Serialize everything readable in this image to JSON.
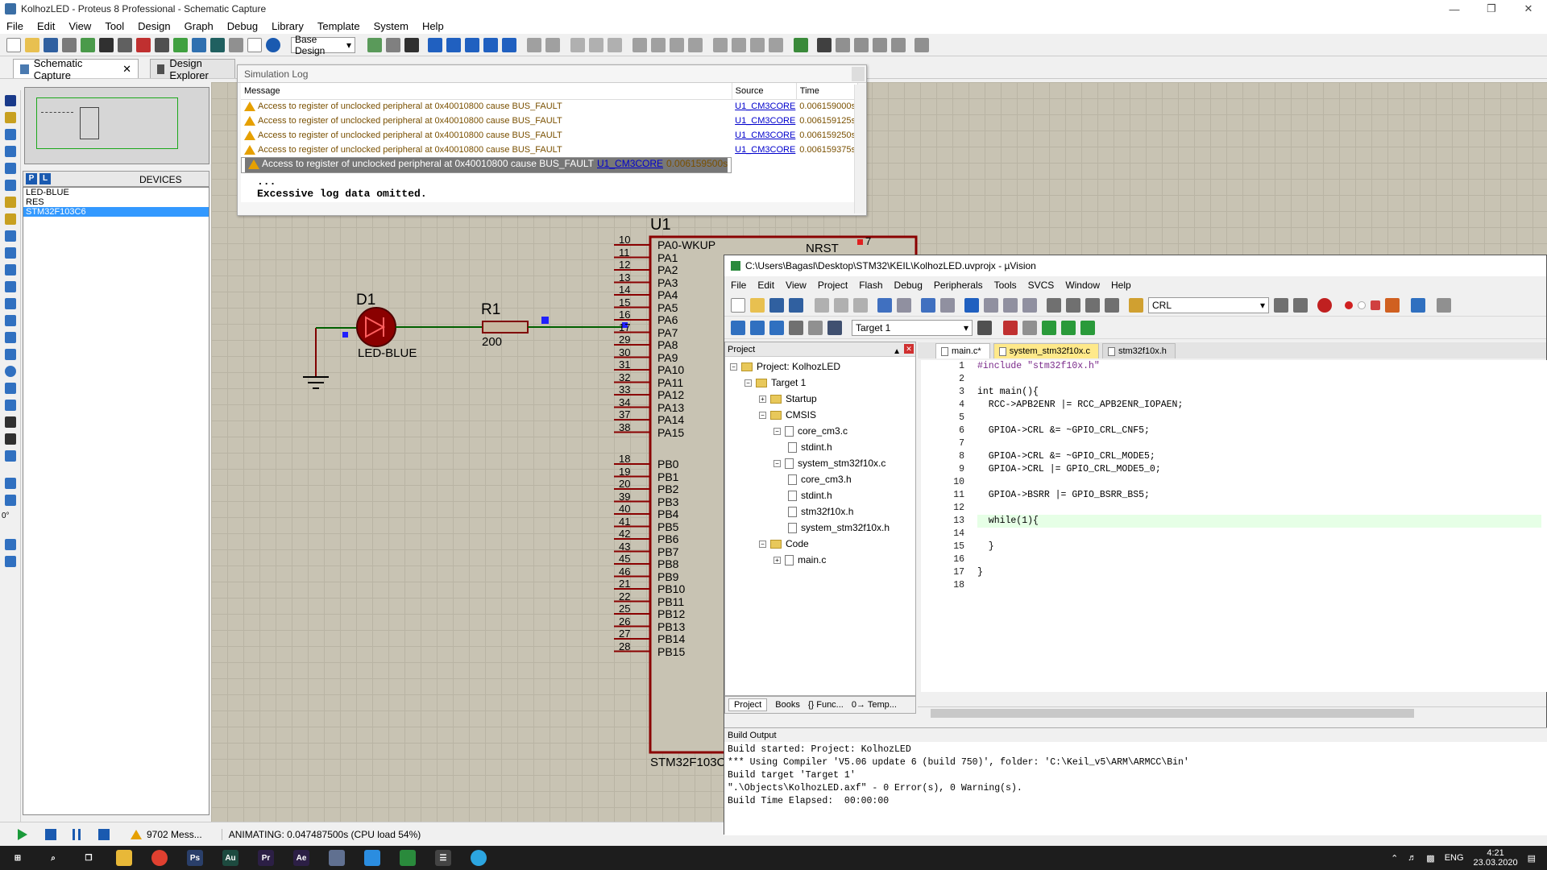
{
  "proteus": {
    "title": "KolhozLED - Proteus 8 Professional - Schematic Capture",
    "menu": [
      "File",
      "Edit",
      "View",
      "Tool",
      "Design",
      "Graph",
      "Debug",
      "Library",
      "Template",
      "System",
      "Help"
    ],
    "design_select": "Base Design",
    "tabs": {
      "schematic": "Schematic Capture",
      "explorer": "Design Explorer"
    },
    "devices_label": "DEVICES",
    "devices_p": "P",
    "devices_l": "L",
    "devices": [
      "LED-BLUE",
      "RES",
      "STM32F103C6"
    ],
    "rotation": "0°",
    "status_messages": "9702 Mess...",
    "status_animating": "ANIMATING: 0.047487500s (CPU load 54%)"
  },
  "simlog": {
    "title": "Simulation Log",
    "columns": [
      "Message",
      "Source",
      "Time"
    ],
    "rows": [
      {
        "message": "Access to register of unclocked peripheral at 0x40010800 cause BUS_FAULT",
        "source": "U1_CM3CORE",
        "time": "0.006159000s"
      },
      {
        "message": "Access to register of unclocked peripheral at 0x40010800 cause BUS_FAULT",
        "source": "U1_CM3CORE",
        "time": "0.006159125s"
      },
      {
        "message": "Access to register of unclocked peripheral at 0x40010800 cause BUS_FAULT",
        "source": "U1_CM3CORE",
        "time": "0.006159250s"
      },
      {
        "message": "Access to register of unclocked peripheral at 0x40010800 cause BUS_FAULT",
        "source": "U1_CM3CORE",
        "time": "0.006159375s"
      },
      {
        "message": "Access to register of unclocked peripheral at 0x40010800 cause BUS_FAULT",
        "source": "U1_CM3CORE",
        "time": "0.006159500s"
      }
    ],
    "ellipsis": "...",
    "omitted": "Excessive log data omitted."
  },
  "schematic": {
    "u1_ref": "U1",
    "u1_part": "STM32F103C6",
    "nrst_label": "NRST",
    "nrst_pin": "7",
    "d1_ref": "D1",
    "d1_value": "LED-BLUE",
    "r1_ref": "R1",
    "r1_value": "200",
    "pins_a": [
      [
        "10",
        "PA0-WKUP"
      ],
      [
        "11",
        "PA1"
      ],
      [
        "12",
        "PA2"
      ],
      [
        "13",
        "PA3"
      ],
      [
        "14",
        "PA4"
      ],
      [
        "15",
        "PA5"
      ],
      [
        "16",
        "PA6"
      ],
      [
        "17",
        "PA7"
      ],
      [
        "29",
        "PA8"
      ],
      [
        "30",
        "PA9"
      ],
      [
        "31",
        "PA10"
      ],
      [
        "32",
        "PA11"
      ],
      [
        "33",
        "PA12"
      ],
      [
        "34",
        "PA13"
      ],
      [
        "37",
        "PA14"
      ],
      [
        "38",
        "PA15"
      ]
    ],
    "pins_b": [
      [
        "18",
        "PB0"
      ],
      [
        "19",
        "PB1"
      ],
      [
        "20",
        "PB2"
      ],
      [
        "39",
        "PB3"
      ],
      [
        "40",
        "PB4"
      ],
      [
        "41",
        "PB5"
      ],
      [
        "42",
        "PB6"
      ],
      [
        "43",
        "PB7"
      ],
      [
        "45",
        "PB8"
      ],
      [
        "46",
        "PB9"
      ],
      [
        "21",
        "PB10"
      ],
      [
        "22",
        "PB11"
      ],
      [
        "25",
        "PB12"
      ],
      [
        "26",
        "PB13"
      ],
      [
        "27",
        "PB14"
      ],
      [
        "28",
        "PB15"
      ]
    ]
  },
  "keil": {
    "title": "C:\\Users\\Bagasl\\Desktop\\STM32\\KEIL\\KolhozLED.uvprojx - µVision",
    "menu": [
      "File",
      "Edit",
      "View",
      "Project",
      "Flash",
      "Debug",
      "Peripherals",
      "Tools",
      "SVCS",
      "Window",
      "Help"
    ],
    "find_value": "CRL",
    "target_select": "Target 1",
    "project_panel_title": "Project",
    "tree": [
      {
        "depth": 0,
        "label": "Project: KolhozLED",
        "kind": "proj"
      },
      {
        "depth": 1,
        "label": "Target 1",
        "kind": "folder"
      },
      {
        "depth": 2,
        "label": "Startup",
        "kind": "folder"
      },
      {
        "depth": 2,
        "label": "CMSIS",
        "kind": "folder"
      },
      {
        "depth": 3,
        "label": "core_cm3.c",
        "kind": "file"
      },
      {
        "depth": 4,
        "label": "stdint.h",
        "kind": "file"
      },
      {
        "depth": 3,
        "label": "system_stm32f10x.c",
        "kind": "file"
      },
      {
        "depth": 4,
        "label": "core_cm3.h",
        "kind": "file"
      },
      {
        "depth": 4,
        "label": "stdint.h",
        "kind": "file"
      },
      {
        "depth": 4,
        "label": "stm32f10x.h",
        "kind": "file"
      },
      {
        "depth": 4,
        "label": "system_stm32f10x.h",
        "kind": "file"
      },
      {
        "depth": 2,
        "label": "Code",
        "kind": "folder"
      },
      {
        "depth": 3,
        "label": "main.c",
        "kind": "file"
      }
    ],
    "panel_tabs": [
      "Project",
      "Books",
      "{} Func...",
      "0→ Temp..."
    ],
    "editor_tabs": [
      "main.c*",
      "system_stm32f10x.c",
      "stm32f10x.h"
    ],
    "code": [
      "#include \"stm32f10x.h\"",
      "",
      "int main(){",
      "  RCC->APB2ENR |= RCC_APB2ENR_IOPAEN;",
      "",
      "  GPIOA->CRL &= ~GPIO_CRL_CNF5;",
      "",
      "  GPIOA->CRL &= ~GPIO_CRL_MODE5;",
      "  GPIOA->CRL |= GPIO_CRL_MODE5_0;",
      "",
      "  GPIOA->BSRR |= GPIO_BSRR_BS5;",
      "",
      "  while(1){",
      "",
      "  }",
      "",
      "}",
      ""
    ],
    "build_output_title": "Build Output",
    "build_output": [
      "Build started: Project: KolhozLED",
      "*** Using Compiler 'V5.06 update 6 (build 750)', folder: 'C:\\Keil_v5\\ARM\\ARMCC\\Bin'",
      "Build target 'Target 1'",
      "\".\\Objects\\KolhozLED.axf\" - 0 Error(s), 0 Warning(s).",
      "Build Time Elapsed:  00:00:00"
    ]
  },
  "taskbar": {
    "lang": "ENG",
    "time": "4:21",
    "date": "23.03.2020",
    "apps": [
      {
        "name": "start-icon",
        "glyph": "⊞",
        "color": "#ffffff"
      },
      {
        "name": "search-icon",
        "glyph": "⌕",
        "color": "#ffffff"
      },
      {
        "name": "task-view-icon",
        "glyph": "❐",
        "color": "#ffffff"
      },
      {
        "name": "file-explorer-icon",
        "glyph": "",
        "color": "#e8b838"
      },
      {
        "name": "chrome-icon",
        "glyph": "",
        "color": "#e04030"
      },
      {
        "name": "photoshop-icon",
        "glyph": "Ps",
        "color": "#2a3f6a"
      },
      {
        "name": "audition-icon",
        "glyph": "Au",
        "color": "#1d4a3f"
      },
      {
        "name": "premiere-icon",
        "glyph": "Pr",
        "color": "#2c1f45"
      },
      {
        "name": "after-effects-icon",
        "glyph": "Ae",
        "color": "#2c1f45"
      },
      {
        "name": "proteus-icon",
        "glyph": "",
        "color": "#607090"
      },
      {
        "name": "vscode-icon",
        "glyph": "",
        "color": "#2b8de0"
      },
      {
        "name": "keil-icon",
        "glyph": "",
        "color": "#2a8a3c"
      },
      {
        "name": "calculator-icon",
        "glyph": "☰",
        "color": "#444444"
      },
      {
        "name": "telegram-icon",
        "glyph": "",
        "color": "#2ca5e0"
      }
    ]
  }
}
